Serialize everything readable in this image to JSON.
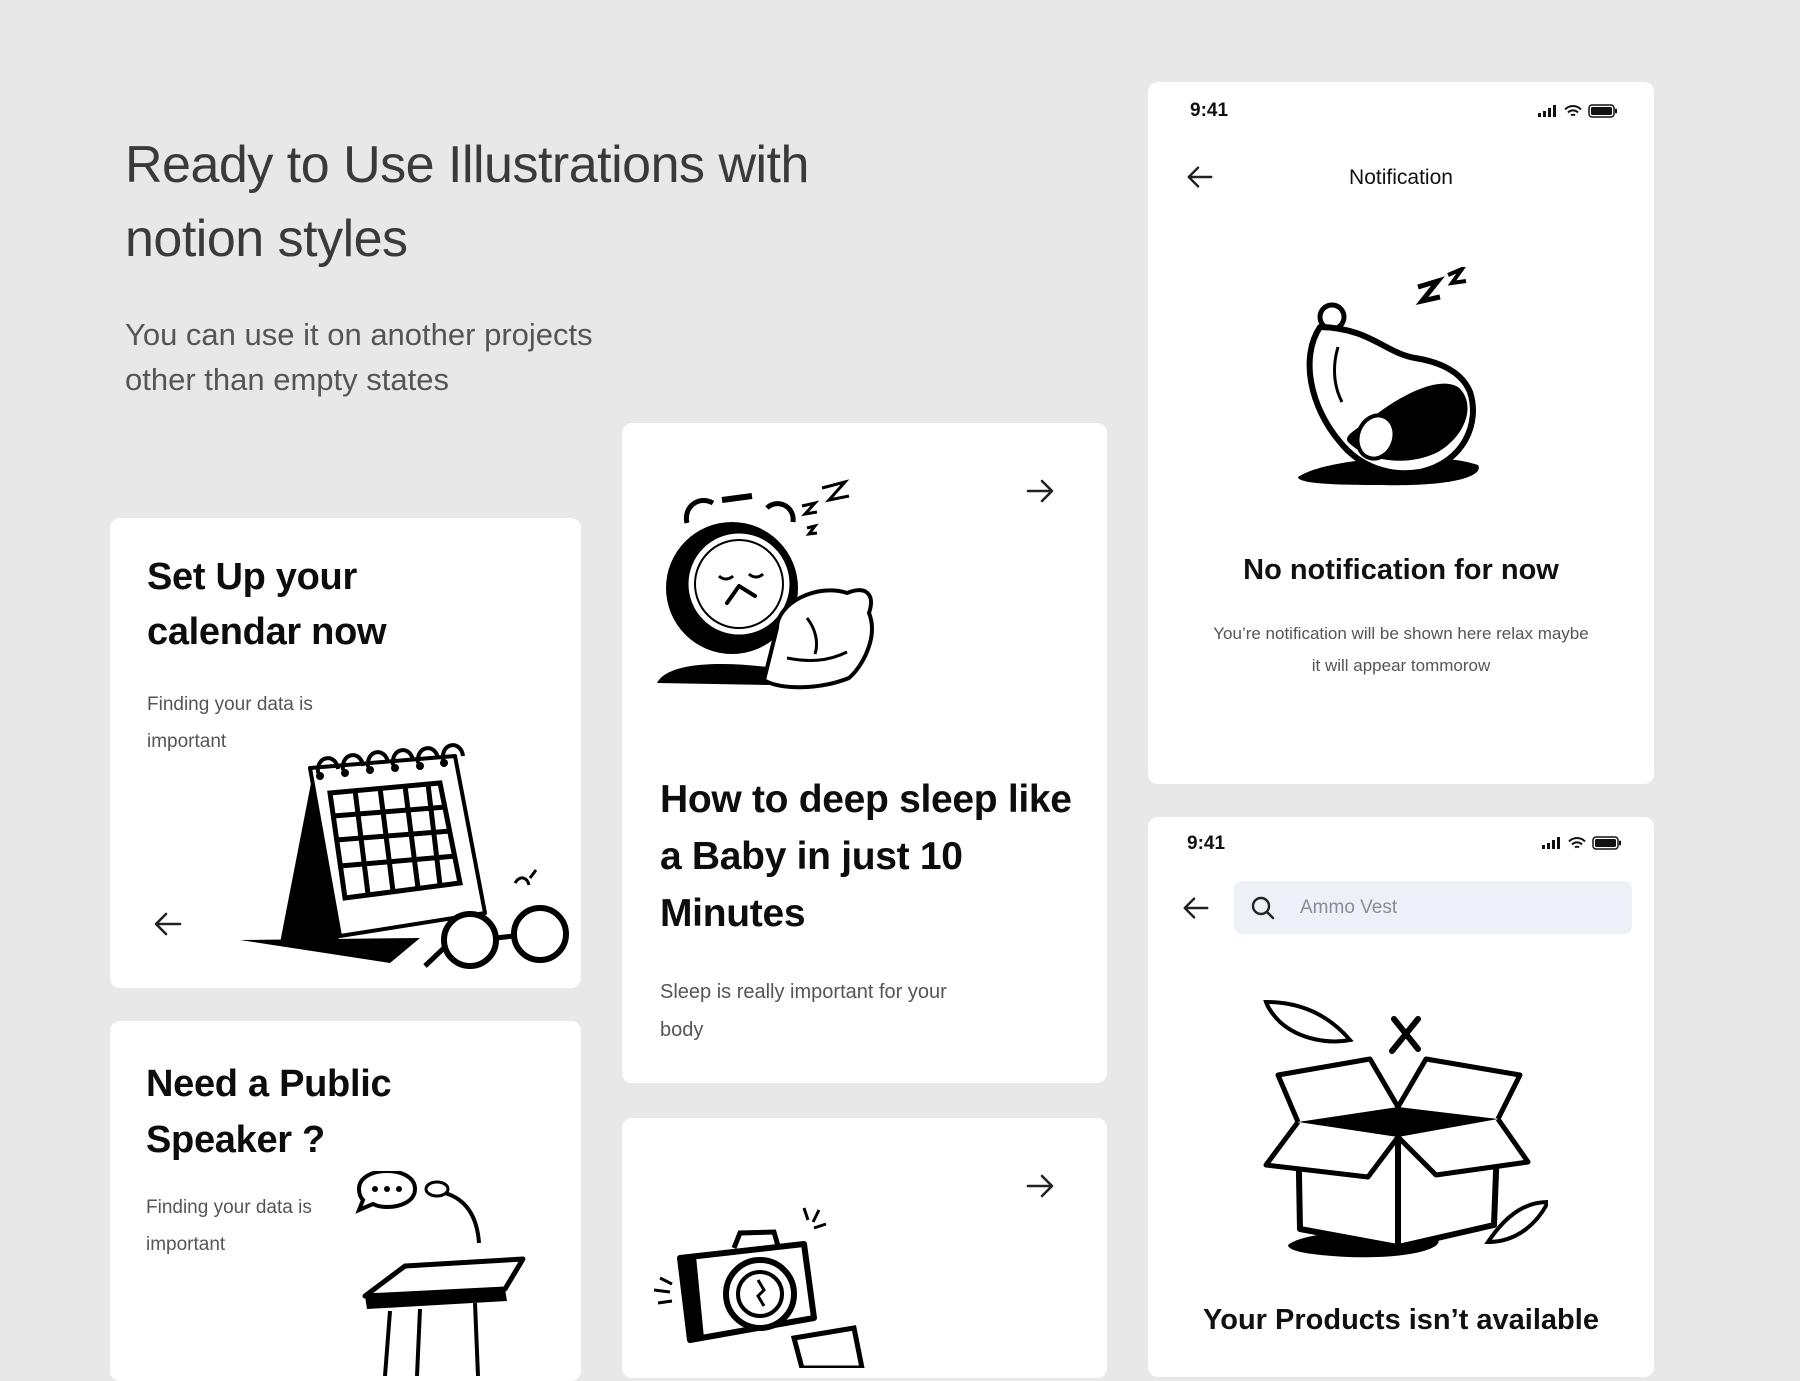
{
  "hero": {
    "title": "Ready to Use Illustrations with notion styles",
    "subtitle": "You can use it on another projects other than empty states"
  },
  "cards": {
    "calendar": {
      "title": "Set Up your calendar now",
      "desc": "Finding your data is important"
    },
    "speaker": {
      "title": "Need a Public Speaker ?",
      "desc": "Finding your data is important"
    },
    "sleep": {
      "title": "How to deep sleep like a Baby in just 10 Minutes",
      "desc": "Sleep is really  important for your body"
    }
  },
  "notification_screen": {
    "time": "9:41",
    "nav_title": "Notification",
    "empty_title": "No notification for now",
    "empty_desc": "You’re notification will be shown here relax maybe it will appear tommorow"
  },
  "product_screen": {
    "time": "9:41",
    "search_value": "Ammo Vest",
    "empty_title": "Your Products isn’t available"
  },
  "colors": {
    "background": "#e8e8e8",
    "card": "#ffffff",
    "search_bg": "#eef0f8",
    "ink": "#111111"
  }
}
